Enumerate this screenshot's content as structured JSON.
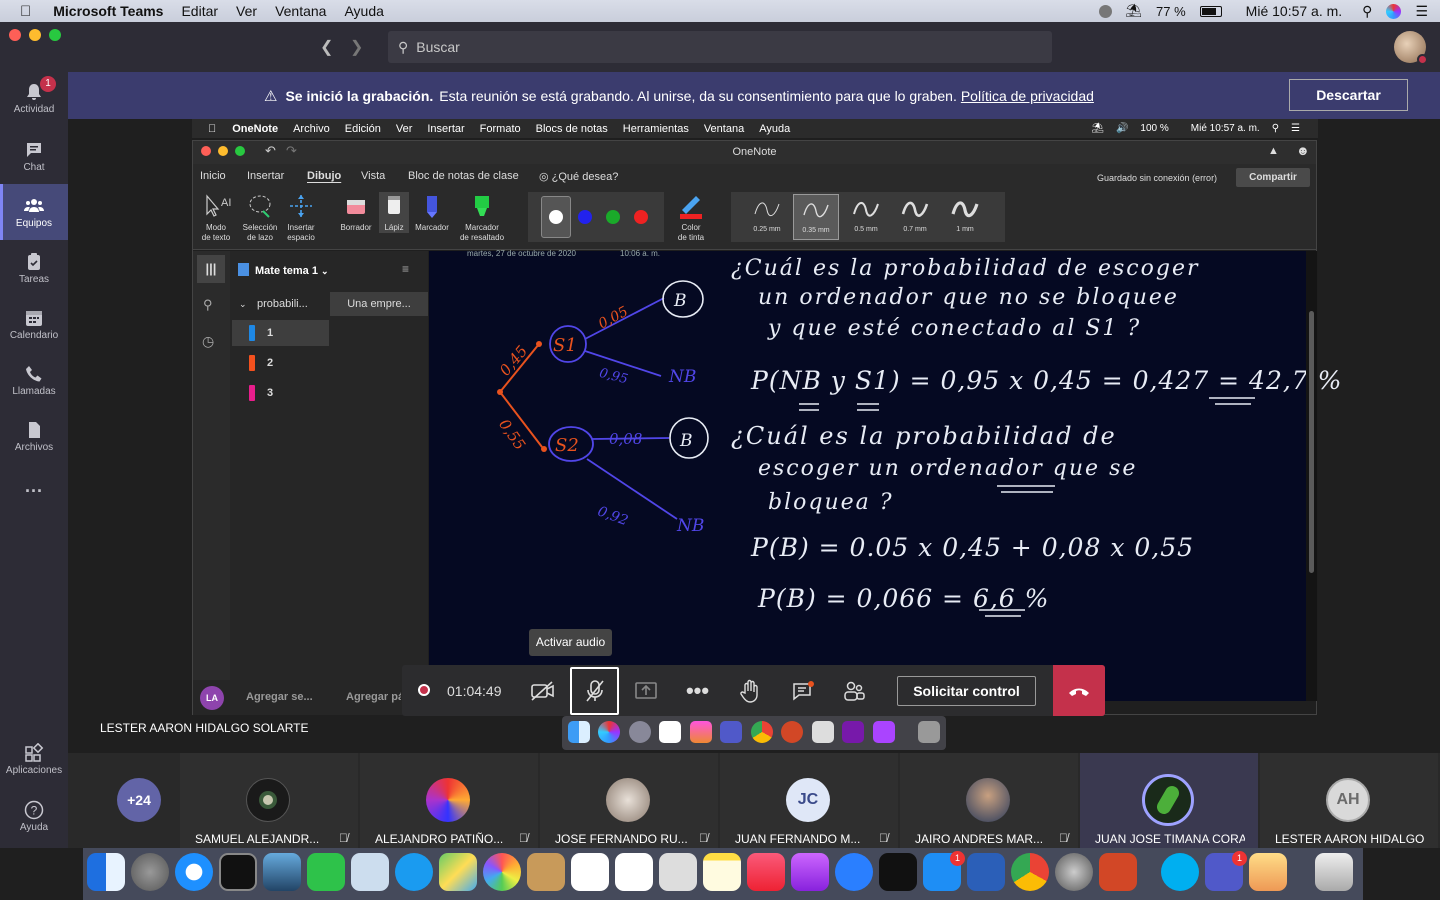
{
  "mac_menubar": {
    "app": "Microsoft Teams",
    "items": [
      "Editar",
      "Ver",
      "Ventana",
      "Ayuda"
    ],
    "battery": "77 %",
    "clock": "Mié 10:57 a. m."
  },
  "teams": {
    "search_placeholder": "Buscar",
    "rail": [
      {
        "label": "Actividad",
        "badge": "1"
      },
      {
        "label": "Chat"
      },
      {
        "label": "Equipos"
      },
      {
        "label": "Tareas"
      },
      {
        "label": "Calendario"
      },
      {
        "label": "Llamadas"
      },
      {
        "label": "Archivos"
      },
      {
        "label": "..."
      }
    ],
    "rail_bottom": [
      "Aplicaciones",
      "Ayuda"
    ],
    "banner": {
      "bold": "Se inició la grabación.",
      "text": "Esta reunión se está grabando. Al unirse, da su consentimiento para que lo graben.",
      "link": "Política de privacidad",
      "dismiss": "Descartar"
    },
    "tooltip": "Activar audio",
    "recording_time": "01:04:49",
    "request_control": "Solicitar control",
    "presenter_name": "LESTER AARON HIDALGO SOLARTE",
    "participants_more": "+24",
    "participants": [
      {
        "name": "SAMUEL ALEJANDR...",
        "muted": true
      },
      {
        "name": "ALEJANDRO PATIÑO...",
        "muted": true
      },
      {
        "name": "JOSE FERNANDO RU...",
        "muted": true
      },
      {
        "name": "JUAN FERNANDO M...",
        "initials": "JC",
        "muted": true
      },
      {
        "name": "JAIRO ANDRES MAR...",
        "muted": true
      },
      {
        "name": "JUAN JOSE TIMANA CORAL",
        "muted": false
      },
      {
        "name": "LESTER AARON HIDALGO ...",
        "initials": "AH",
        "muted": false
      }
    ]
  },
  "shared": {
    "menubar": {
      "app": "OneNote",
      "items": [
        "Archivo",
        "Edición",
        "Ver",
        "Insertar",
        "Formato",
        "Blocs de notas",
        "Herramientas",
        "Ventana",
        "Ayuda"
      ],
      "battery": "100 %",
      "clock": "Mié 10:57 a. m."
    },
    "window_title": "OneNote",
    "tabs": [
      "Inicio",
      "Insertar",
      "Dibujo",
      "Vista",
      "Bloc de notas de clase",
      "¿Qué desea?"
    ],
    "selected_tab": "Dibujo",
    "saved_status": "Guardado sin conexión (error)",
    "share_button": "Compartir",
    "tools": [
      {
        "l1": "Modo",
        "l2": "de texto"
      },
      {
        "l1": "Selección",
        "l2": "de lazo"
      },
      {
        "l1": "Insertar",
        "l2": "espacio"
      },
      {
        "l1": "Borrador",
        "l2": ""
      },
      {
        "l1": "Lápiz",
        "l2": ""
      },
      {
        "l1": "Marcador",
        "l2": ""
      },
      {
        "l1": "Marcador",
        "l2": "de resaltado"
      },
      {
        "l1": "Color",
        "l2": "de tinta"
      }
    ],
    "thicknesses": [
      "0.25 mm",
      "0.35 mm",
      "0.5 mm",
      "0.7 mm",
      "1 mm"
    ],
    "selected_thickness": "0.35 mm",
    "notebook": "Mate tema 1",
    "section": "probabili...",
    "page_title": "Una empre...",
    "pages": [
      {
        "label": "1",
        "color": "#1e88e5"
      },
      {
        "label": "2",
        "color": "#f4511e"
      },
      {
        "label": "3",
        "color": "#e91e8c"
      }
    ],
    "user_initials": "LA",
    "add_section": "Agregar se...",
    "add_page": "Agregar pá",
    "date": "martes, 27 de octubre de 2020",
    "time": "10:06 a. m.",
    "handwriting": {
      "q1_l1": "¿Cuál es la probabilidad de escoger",
      "q1_l2": "un ordenador que no se bloquee",
      "q1_l3": "y que esté conectado al S1 ?",
      "eq1": "P(NB y S1) = 0,95 x 0,45 = 0,427 = 42,7 %",
      "q2_l1": "¿Cuál es la probabilidad de",
      "q2_l2": "escoger un ordenador que se",
      "q2_l3": "bloquea ?",
      "eq2": "P(B) = 0.05 x 0,45 + 0,08 x 0,55",
      "eq3": "P(B) = 0,066 = 6,6 %"
    },
    "tree": {
      "root_probs": [
        "0,45",
        "0,55"
      ],
      "nodes": [
        "S1",
        "S2"
      ],
      "s1_branches": [
        {
          "prob": "0,05",
          "leaf": "B"
        },
        {
          "prob": "0,95",
          "leaf": "NB"
        }
      ],
      "s2_branches": [
        {
          "prob": "0,08",
          "leaf": "B"
        },
        {
          "prob": "0,92",
          "leaf": "NB"
        }
      ]
    }
  },
  "colors": {
    "teams_accent": "#6264a7",
    "hangup": "#c4314b",
    "canvas_bg": "#050922",
    "tree_red": "#e8521e",
    "tree_blue": "#5146e8"
  }
}
